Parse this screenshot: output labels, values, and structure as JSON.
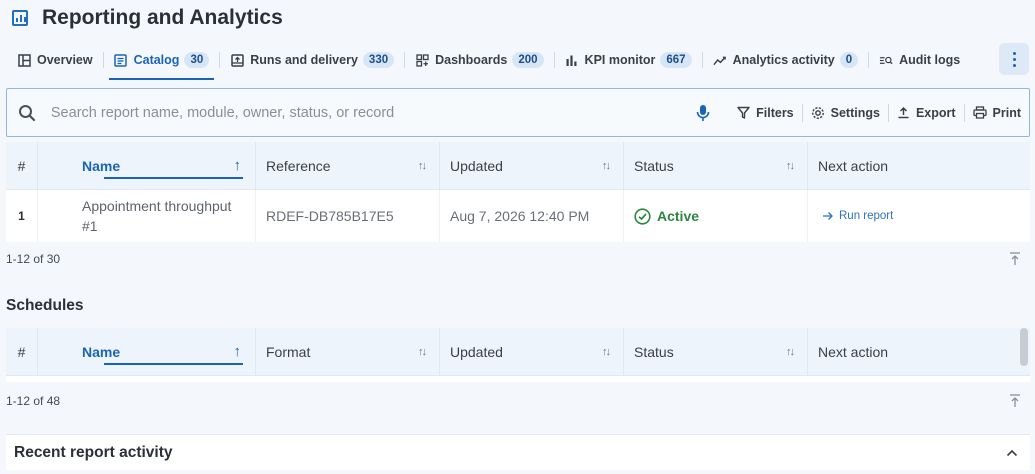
{
  "app": {
    "title": "Reporting and Analytics"
  },
  "tabs": [
    {
      "label": "Overview",
      "icon": "layout-icon",
      "badge": null
    },
    {
      "label": "Catalog",
      "icon": "document-list-icon",
      "badge": "30"
    },
    {
      "label": "Runs and delivery",
      "icon": "inbox-upload-icon",
      "badge": "330"
    },
    {
      "label": "Dashboards",
      "icon": "dashboard-grid-icon",
      "badge": "200"
    },
    {
      "label": "KPI monitor",
      "icon": "bar-chart-icon",
      "badge": "667"
    },
    {
      "label": "Analytics activity",
      "icon": "trend-line-icon",
      "badge": "0"
    },
    {
      "label": "Audit logs",
      "icon": "audit-search-icon",
      "badge": null
    }
  ],
  "search": {
    "placeholder": "Search report name, module, owner, status, or record",
    "value": ""
  },
  "toolbar": {
    "filters": "Filters",
    "settings": "Settings",
    "export": "Export",
    "print": "Print"
  },
  "catalog": {
    "columns": [
      "#",
      "Name",
      "Reference",
      "Updated",
      "Status",
      "Next action"
    ],
    "rows": [
      {
        "num": "1",
        "name": "Appointment throughput #1",
        "reference": "RDEF-DB785B17E5",
        "updated": "Aug 7, 2026 12:40 PM",
        "status": "Active",
        "action": "Run report"
      }
    ],
    "pagination": "1-12 of 30"
  },
  "schedules": {
    "title": "Schedules",
    "columns": [
      "#",
      "Name",
      "Format",
      "Updated",
      "Status",
      "Next action"
    ],
    "pagination": "1-12 of 48"
  },
  "recent": {
    "title": "Recent report activity"
  },
  "colors": {
    "accent": "#1a64b8",
    "success": "#2e8540",
    "background": "#f4f8fc",
    "header_bg": "#eef4fb"
  }
}
